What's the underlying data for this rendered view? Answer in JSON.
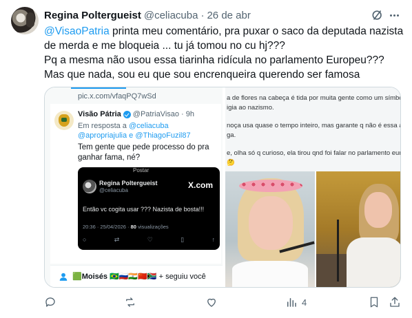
{
  "author": {
    "name": "Regina Poltergueist",
    "handle": "@celiacuba",
    "separator": "·",
    "date": "26 de abr"
  },
  "tweet": {
    "mention": "@VisaoPatria",
    "line1_rest": " printa meu comentário, pra puxar o saco da deputada nazista",
    "line2": "de merda e me bloqueia ... tu já tomou no cu hj???",
    "line3": "Pq a mesma não usou essa tiarinha ridícula no parlamento Europeu???",
    "line4": "Mas que nada, sou eu que sou encrenqueira querendo ser famosa"
  },
  "media_left": {
    "pic_url": "pic.x.com/vfaqPQ7wSd",
    "quoted": {
      "name": "Visão Pátria",
      "handle": "@PatriaVisao",
      "time": "· 9h",
      "reply_prefix": "Em resposta a ",
      "reply_mentions": "@celiacuba @apropriajulia e @ThiagoFuzil87",
      "body": "Tem gente que pede processo do pra ganhar fama, né?",
      "card": {
        "top_label": "Postar",
        "name": "Regina Poltergueist",
        "handle": "@celiacuba",
        "brand": "X.com",
        "text": "Então vc cogita usar ??? Nazista de bosta!!!",
        "meta_prefix": "20:36 · 25/04/2026 · ",
        "views": "80",
        "meta_suffix": " visualizações"
      }
    },
    "follow": {
      "name": "🟩Moisés 🇧🇷🇷🇺🇮🇳🇨🇳🇿🇦",
      "suffix": " + seguiu você"
    }
  },
  "media_right": {
    "lines": [
      "a de flores na cabeça é tida por muita gente como um símbo",
      "igia ao nazismo.",
      "noça usa quase o tempo inteiro, mas garante q não é essa a",
      "ga.",
      "e, olha só q curioso, ela tirou qnd foi falar no parlamento eur",
      "🤔"
    ]
  },
  "actions": {
    "views": "4"
  },
  "colors": {
    "accent": "#1d9bf0",
    "text": "#0f1419",
    "muted": "#536471",
    "border": "#cfd9de"
  }
}
